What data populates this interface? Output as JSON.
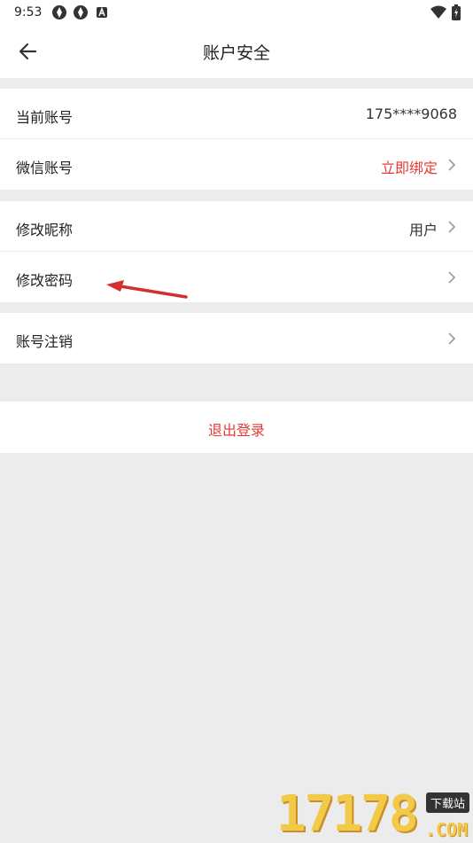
{
  "status_bar": {
    "time": "9:53"
  },
  "header": {
    "title": "账户安全"
  },
  "group1": {
    "account_label": "当前账号",
    "account_value": "175****9068",
    "wechat_label": "微信账号",
    "wechat_value": "立即绑定"
  },
  "group2": {
    "nickname_label": "修改昵称",
    "nickname_value": "用户",
    "password_label": "修改密码"
  },
  "group3": {
    "cancel_label": "账号注销"
  },
  "logout": {
    "label": "退出登录"
  },
  "watermark": {
    "digits": "17178",
    "badge": "下载站",
    "suffix": ".COM"
  },
  "colors": {
    "accent_red": "#e53935",
    "background": "#ececec",
    "card": "#ffffff"
  }
}
